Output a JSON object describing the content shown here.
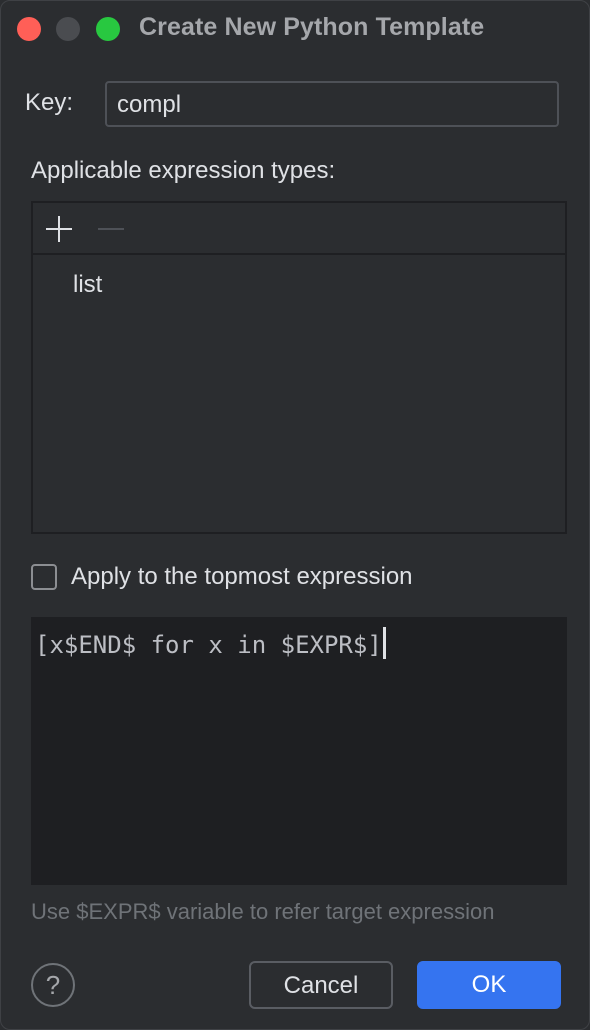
{
  "window": {
    "title": "Create New Python Template"
  },
  "key": {
    "label": "Key:",
    "value": "compl"
  },
  "types": {
    "label": "Applicable expression types:",
    "add_icon": "plus-icon",
    "remove_icon": "minus-icon",
    "items": [
      "list"
    ]
  },
  "apply": {
    "label": "Apply to the topmost expression",
    "checked": false
  },
  "editor": {
    "code": "[x$END$ for x in $EXPR$]"
  },
  "hint": "Use $EXPR$ variable to refer target expression",
  "buttons": {
    "help": "?",
    "cancel": "Cancel",
    "ok": "OK"
  },
  "colors": {
    "background": "#2b2d30",
    "editor_bg": "#1e1f22",
    "accent": "#3574f0",
    "close": "#ff5f57",
    "zoom": "#28c840"
  }
}
